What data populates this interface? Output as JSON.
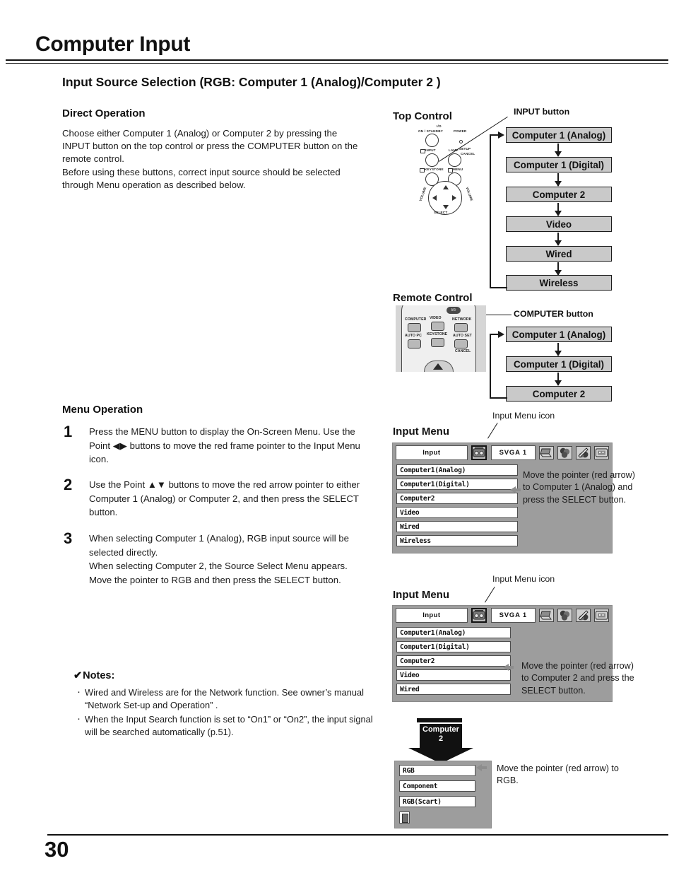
{
  "page": {
    "title": "Computer Input",
    "number": "30",
    "section_title": "Input Source Selection (RGB: Computer 1 (Analog)/Computer 2 )"
  },
  "direct_operation": {
    "heading": "Direct Operation",
    "paragraph": "Choose either Computer 1 (Analog) or Computer 2 by pressing the INPUT button on the top control or press the COMPUTER button on the remote control.\nBefore using these buttons, correct input source should be selected through Menu operation as described below."
  },
  "top_control": {
    "heading": "Top Control",
    "callout": "INPUT button",
    "panel_labels": {
      "on_standby": "ON / STANDBY",
      "power": "POWER",
      "io": "I/O",
      "input": "INPUT",
      "lamp": "LAMP",
      "info": "INFO.",
      "setup": "SETUP",
      "cancel": "CANCEL",
      "keystone": "KEYSTONE",
      "menu": "MENU",
      "volume": "VOLUME",
      "select": "SELECT"
    },
    "flow": [
      "Computer 1 (Analog)",
      "Computer 1 (Digital)",
      "Computer 2",
      "Video",
      "Wired",
      "Wireless"
    ]
  },
  "remote_control": {
    "heading": "Remote Control",
    "callout": "COMPUTER button",
    "keys": {
      "computer": "COMPUTER",
      "video": "VIDEO",
      "network": "NETWORK",
      "auto_pc": "AUTO PC",
      "keystone": "KEYSTONE",
      "auto_set": "AUTO SET",
      "cancel": "CANCEL",
      "power": "I/⏻"
    },
    "flow": [
      "Computer 1 (Analog)",
      "Computer 1 (Digital)",
      "Computer 2"
    ]
  },
  "menu_operation": {
    "heading": "Menu Operation",
    "steps": [
      {
        "number": "1",
        "text": "Press the MENU button to display the On-Screen Menu. Use the Point ◀▶ buttons to move the red frame pointer to the Input Menu icon."
      },
      {
        "number": "2",
        "text": "Use the Point ▲▼ buttons to move the red arrow pointer to either Computer 1 (Analog) or Computer 2, and then press the SELECT button."
      },
      {
        "number": "3",
        "text": "When selecting Computer 1 (Analog), RGB input source will be selected directly.\nWhen selecting Computer 2, the Source Select Menu appears. Move the pointer to RGB and then press the SELECT button."
      }
    ]
  },
  "input_menu_1": {
    "heading": "Input Menu",
    "icon_callout": "Input Menu icon",
    "bar": {
      "input_label": "Input",
      "system_label": "SVGA 1",
      "icons": [
        "input-menu-icon",
        "pc-adjust-icon",
        "color-adjust-icon",
        "image-select-icon",
        "screen-icon"
      ]
    },
    "items": [
      "Computer1(Analog)",
      "Computer1(Digital)",
      "Computer2",
      "Video",
      "Wired",
      "Wireless"
    ],
    "pointer_on_index": 1,
    "annotation": "Move the pointer (red arrow) to Computer 1 (Analog) and press the SELECT button."
  },
  "input_menu_2": {
    "heading": "Input Menu",
    "icon_callout": "Input Menu icon",
    "bar": {
      "input_label": "Input",
      "system_label": "SVGA 1"
    },
    "items": [
      "Computer1(Analog)",
      "Computer1(Digital)",
      "Computer2",
      "Video",
      "Wired"
    ],
    "pointer_on_index": 2,
    "annotation": "Move the pointer (red arrow) to Computer 2 and press the SELECT button."
  },
  "source_select": {
    "arrow_label_line1": "Computer",
    "arrow_label_line2": "2",
    "items": [
      "RGB",
      "Component",
      "RGB(Scart)"
    ],
    "pointer_on_index": 0,
    "exit_icon": "exit-door-icon",
    "annotation": "Move the pointer (red arrow) to RGB."
  },
  "notes": {
    "heading": "Notes:",
    "check": "✔",
    "items": [
      "Wired and Wireless are for the Network function.  See owner’s manual “Network Set-up and Operation” .",
      "When the Input Search function is set to “On1” or “On2”, the input signal will be searched automatically (p.51)."
    ]
  }
}
